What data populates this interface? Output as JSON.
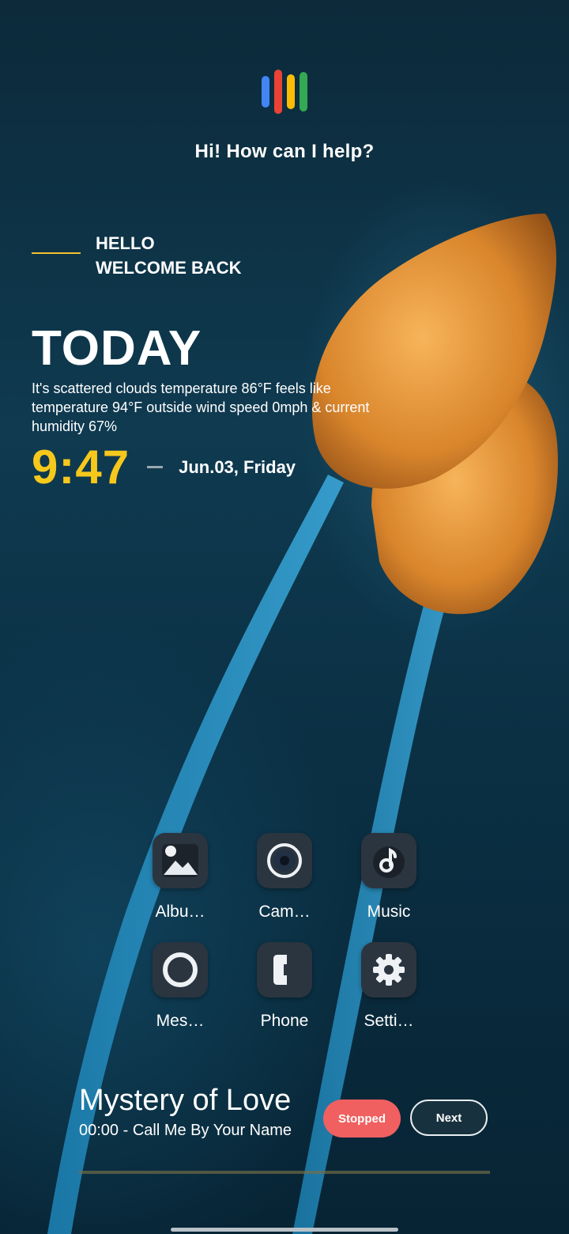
{
  "assistant": {
    "prompt": "Hi! How can I help?",
    "bar_colors": [
      "#4285f4",
      "#ea4335",
      "#fbbc05",
      "#34a853"
    ]
  },
  "greeting": {
    "line1": "HELLO",
    "line2": "WELCOME BACK",
    "accent_color": "#f2c12e"
  },
  "today": {
    "heading": "TODAY",
    "weather": "It's scattered clouds temperature 86°F feels like temperature 94°F outside wind speed 0mph & current humidity 67%",
    "time": "9:47",
    "date": "Jun.03, Friday",
    "time_color": "#f6c81c"
  },
  "apps": [
    {
      "label": "Albu…",
      "icon": "gallery-icon"
    },
    {
      "label": "Cam…",
      "icon": "camera-icon"
    },
    {
      "label": "Music",
      "icon": "music-icon"
    },
    {
      "label": "Mes…",
      "icon": "message-icon"
    },
    {
      "label": "Phone",
      "icon": "phone-icon"
    },
    {
      "label": "Setti…",
      "icon": "gear-icon"
    }
  ],
  "music": {
    "title": "Mystery of Love",
    "subtitle": "00:00 - Call Me By Your Name",
    "stopped_label": "Stopped",
    "next_label": "Next",
    "stopped_color": "#f06060",
    "progress": 0
  }
}
